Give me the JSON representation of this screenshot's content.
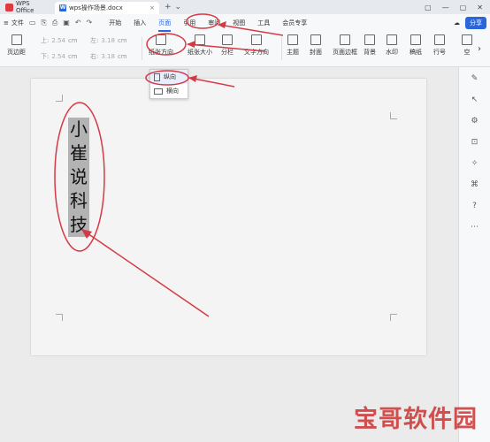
{
  "titlebar": {
    "app_name": "WPS Office",
    "doc_name": "wps操作场景.docx",
    "close_glyph": "×",
    "new_glyph": "+",
    "chev_glyph": "⌄",
    "win_ctrls": [
      "▢",
      "—",
      "▢",
      "✕"
    ]
  },
  "menubar": {
    "menu_glyph": "≡",
    "file_label": "文件",
    "quick_icons": [
      "save-icon",
      "copy-icon",
      "print-icon",
      "preview-icon",
      "undo-icon",
      "redo-icon"
    ],
    "quick_glyphs": [
      "▭",
      "⎘",
      "⎙",
      "▣",
      "↶",
      "↷"
    ],
    "tabs": [
      "开始",
      "插入",
      "页面",
      "引用",
      "审阅",
      "视图",
      "工具",
      "会员专享"
    ],
    "active_tab": "页面",
    "cloud_glyph": "☁",
    "share_label": "分享"
  },
  "ribbon": {
    "margins_label": "页边距",
    "margin_fields": [
      {
        "label": "上:",
        "value": "2.54",
        "unit": "cm"
      },
      {
        "label": "左:",
        "value": "3.18",
        "unit": "cm"
      },
      {
        "label": "下:",
        "value": "2.54",
        "unit": "cm"
      },
      {
        "label": "右:",
        "value": "3.18",
        "unit": "cm"
      }
    ],
    "orientation_label": "纸张方向",
    "size_label": "纸张大小",
    "columns_label": "分栏",
    "text_direction_label": "文字方向",
    "theme_label": "主题",
    "cover_label": "封面",
    "page_border_label": "页面边框",
    "background_label": "背景",
    "watermark_label": "水印",
    "paper_label": "稿纸",
    "line_num_label": "行号",
    "space_label": "空",
    "more_glyph": "›"
  },
  "dropdown": {
    "items": [
      {
        "label": "纵向",
        "selected": true
      },
      {
        "label": "横向",
        "selected": false
      }
    ]
  },
  "document": {
    "text": "小崔说科技"
  },
  "right_panel": {
    "icons": [
      "pen-icon",
      "select-icon",
      "settings-icon",
      "save-icon",
      "magic-icon",
      "share-icon",
      "help-icon",
      "more-icon"
    ],
    "glyphs": [
      "✎",
      "↖",
      "⚙",
      "⊡",
      "✧",
      "⌘",
      "?",
      "⋯"
    ]
  },
  "watermark": {
    "text": "宝哥软件园"
  },
  "colors": {
    "accent": "#2a66d9",
    "annotation": "#d43a45"
  }
}
